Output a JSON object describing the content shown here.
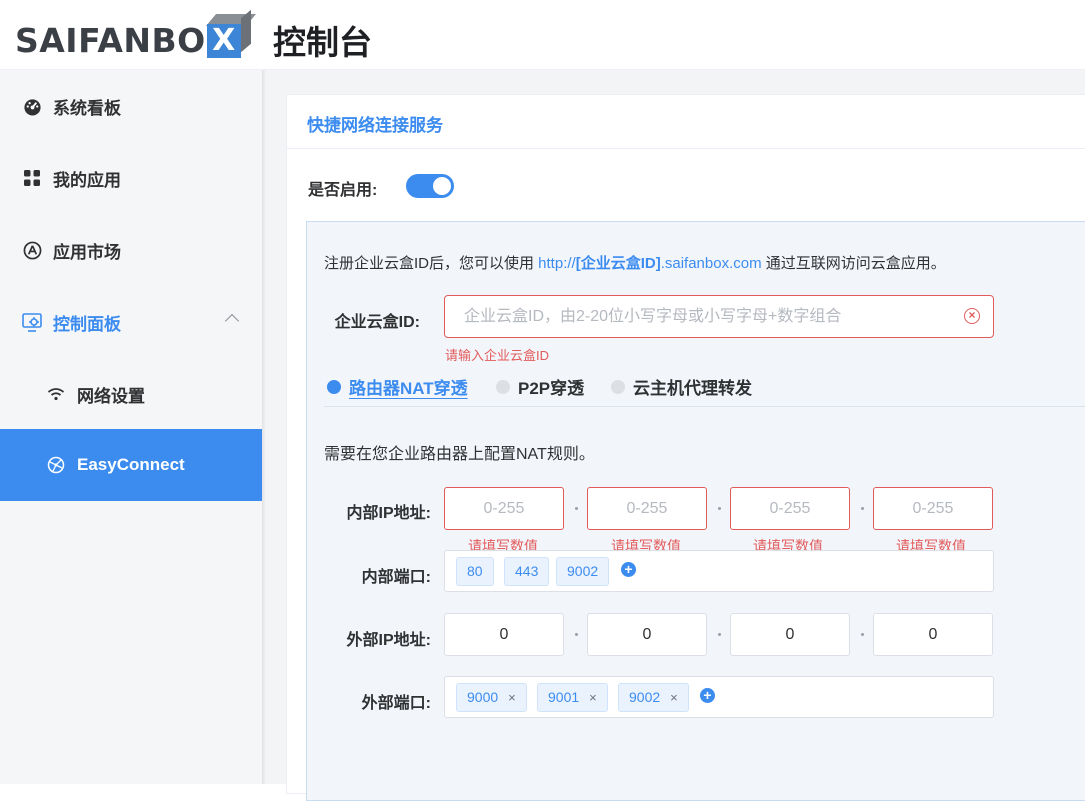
{
  "header": {
    "logo_text": "SAIFANBO",
    "logo_box_letter": "X",
    "title": "控制台"
  },
  "sidebar": {
    "items": [
      {
        "label": "系统看板",
        "icon": "dashboard-gauge-icon"
      },
      {
        "label": "我的应用",
        "icon": "apps-grid-icon"
      },
      {
        "label": "应用市场",
        "icon": "app-store-icon"
      },
      {
        "label": "控制面板",
        "icon": "control-panel-icon",
        "expanded": true
      },
      {
        "label": "网络设置",
        "icon": "wifi-icon"
      },
      {
        "label": "EasyConnect",
        "icon": "network-globe-icon",
        "active": true
      }
    ]
  },
  "card": {
    "title": "快捷网络连接服务",
    "enable_label": "是否启用:",
    "enabled": true
  },
  "info": {
    "prefix": "注册企业云盒ID后，您可以使用 ",
    "url_start": "http://",
    "url_bold": "[企业云盒ID]",
    "url_end": ".saifanbox.com",
    "suffix": " 通过互联网访问云盒应用。"
  },
  "cloud_id": {
    "label": "企业云盒ID:",
    "value": "",
    "placeholder": "企业云盒ID，由2-20位小写字母或小写字母+数字组合",
    "error": "请输入企业云盒ID"
  },
  "tabs": [
    {
      "label": "路由器NAT穿透",
      "active": true
    },
    {
      "label": "P2P穿透",
      "active": false
    },
    {
      "label": "云主机代理转发",
      "active": false
    }
  ],
  "nat": {
    "description": "需要在您企业路由器上配置NAT规则。",
    "internal_ip": {
      "label": "内部IP地址:",
      "placeholder": "0-255",
      "values": [
        "",
        "",
        "",
        ""
      ],
      "error": "请填写数值"
    },
    "internal_port": {
      "label": "内部端口:",
      "tags": [
        "80",
        "443",
        "9002"
      ]
    },
    "external_ip": {
      "label": "外部IP地址:",
      "values": [
        "0",
        "0",
        "0",
        "0"
      ]
    },
    "external_port": {
      "label": "外部端口:",
      "tags": [
        "9000",
        "9001",
        "9002"
      ],
      "remove_symbol": "×"
    }
  },
  "colors": {
    "primary": "#3c8cf0",
    "error": "#e25b5b",
    "sidebar_bg": "#f5f6f8",
    "panel_bg": "#f2f6fb"
  }
}
